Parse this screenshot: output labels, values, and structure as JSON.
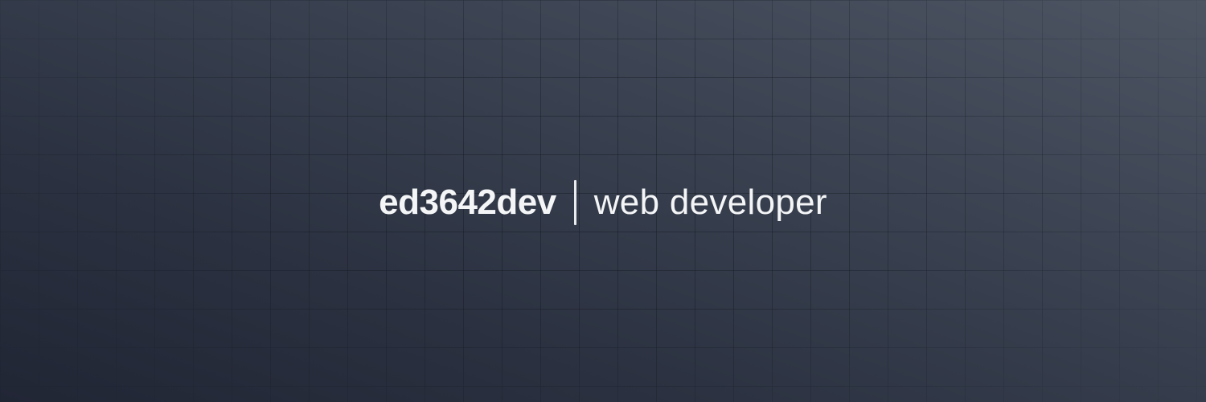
{
  "banner": {
    "handle": "ed3642dev",
    "role": "web developer"
  },
  "colors": {
    "background_top_right": "#4d5563",
    "background_bottom_left": "#212635",
    "text": "#f4f5f7",
    "grid_line": "#141822"
  }
}
